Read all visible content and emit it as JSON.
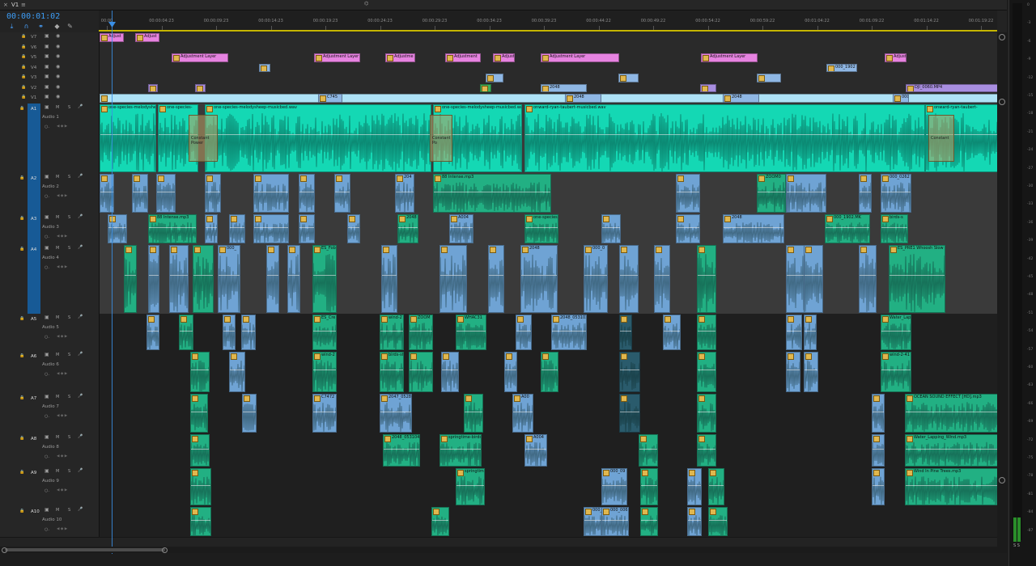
{
  "panel": {
    "tab_label": "V1",
    "menu_icon": "hamburger-menu-icon",
    "close_icon": "close-icon",
    "sequence_marker": "☰",
    "timecode": "00:00:01:02"
  },
  "tools": [
    "snap-icon",
    "linked-selection-icon",
    "add-marker-icon",
    "marker-icon",
    "wrench-icon"
  ],
  "ruler": {
    "labels": [
      "00:00",
      "00:00:04:23",
      "00:00:09:23",
      "00:00:14:23",
      "00:00:19:23",
      "00:00:24:23",
      "00:00:29:23",
      "00:00:34:23",
      "00:00:39:23",
      "00:00:44:22",
      "00:00:49:22",
      "00:00:54:22",
      "00:00:59:22",
      "00:01:04:22",
      "00:01:09:22",
      "00:01:14:22",
      "00:01:19:22"
    ]
  },
  "video_tracks": [
    {
      "label": "V7",
      "clips": [
        {
          "name": "Adjust"
        },
        {
          "name": "Adjust"
        }
      ]
    },
    {
      "label": "V6",
      "clips": []
    },
    {
      "label": "V5",
      "clips": [
        {
          "name": "Adjustment Layer"
        },
        {
          "name": "Adjustment Layer"
        },
        {
          "name": "Adjustme"
        },
        {
          "name": "Adjustment"
        },
        {
          "name": "Adjust"
        },
        {
          "name": "Adjustment Layer"
        },
        {
          "name": "Adjustment Layer"
        },
        {
          "name": "Adjust"
        }
      ]
    },
    {
      "label": "V4",
      "clips": [
        {
          "name": "000_1902"
        }
      ]
    },
    {
      "label": "V3",
      "clips": []
    },
    {
      "label": "V2",
      "clips": [
        {
          "name": "2048"
        },
        {
          "name": "DJI_0060.MP4"
        }
      ]
    },
    {
      "label": "V1",
      "clips": [
        {
          "name": "C745"
        },
        {
          "name": "2048"
        },
        {
          "name": "2048"
        },
        {
          "name": "000_"
        }
      ]
    }
  ],
  "audio_tracks": [
    {
      "label": "A1",
      "name": "Audio 1",
      "clips": [
        {
          "name": "one-species-melodyshee"
        },
        {
          "name": "one-species-"
        },
        {
          "name": "one-species-melodysheep-musicbed.wav"
        },
        {
          "name": "one-species-melodysheep-musicbed.wav"
        },
        {
          "name": "onward-ryan-taubert-musicbed.wav"
        },
        {
          "name": "onward-ryan-taubert-"
        }
      ],
      "transitions": [
        "Constant Power",
        "Constant Po",
        "Constant"
      ]
    },
    {
      "label": "A2",
      "name": "Audio 2",
      "clips": [
        {
          "name": "204"
        },
        {
          "name": "88 Intense.mp3"
        },
        {
          "name": "ZOOM0"
        },
        {
          "name": "000_0262"
        }
      ]
    },
    {
      "label": "A3",
      "name": "Audio 3",
      "clips": [
        {
          "name": "88 Intense.mp3"
        },
        {
          "name": "2048"
        },
        {
          "name": "A004"
        },
        {
          "name": "one-species"
        },
        {
          "name": "2048"
        },
        {
          "name": "000_1902.MK"
        },
        {
          "name": "birds-s"
        }
      ]
    },
    {
      "label": "A4",
      "name": "Audio 4",
      "clips": [
        {
          "name": "000_"
        },
        {
          "name": "ES_Fob"
        },
        {
          "name": "2048"
        },
        {
          "name": "000_0"
        },
        {
          "name": "ES_PRE1 Whoosh Slow 9"
        }
      ]
    },
    {
      "label": "A5",
      "name": "Audio 5",
      "clips": [
        {
          "name": "ES_Cre"
        },
        {
          "name": "wind-2"
        },
        {
          "name": "ZOOM"
        },
        {
          "name": "WHAC31"
        },
        {
          "name": "2048_053103"
        },
        {
          "name": "Water_Lap"
        }
      ]
    },
    {
      "label": "A6",
      "name": "Audio 6",
      "clips": [
        {
          "name": "wind-2"
        },
        {
          "name": "birds-st"
        },
        {
          "name": "wind-2-41"
        }
      ]
    },
    {
      "label": "A7",
      "name": "Audio 7",
      "clips": [
        {
          "name": "C7472"
        },
        {
          "name": "2047_0528"
        },
        {
          "name": "A00"
        },
        {
          "name": "OCEAN SOUND EFFECT [HD].mp3"
        }
      ]
    },
    {
      "label": "A8",
      "name": "Audio 8",
      "clips": [
        {
          "name": "2048_053104"
        },
        {
          "name": "springtime-birds"
        },
        {
          "name": "A004"
        },
        {
          "name": "Water_Lapping_Wind.mp3"
        }
      ]
    },
    {
      "label": "A9",
      "name": "Audio 9",
      "clips": [
        {
          "name": "springtim"
        },
        {
          "name": "000_09"
        },
        {
          "name": "Wind In Pine Trees.mp3"
        }
      ]
    },
    {
      "label": "A10",
      "name": "Audio 10",
      "clips": [
        {
          "name": "000_0"
        },
        {
          "name": "000_0066"
        }
      ]
    }
  ],
  "meter": {
    "labels": [
      "0",
      "-3",
      "-6",
      "-9",
      "-12",
      "-15",
      "-18",
      "-21",
      "-24",
      "-27",
      "-30",
      "-33",
      "-36",
      "-39",
      "-42",
      "-45",
      "-48",
      "-51",
      "-54",
      "-57",
      "-60",
      "-63",
      "-66",
      "-69",
      "-72",
      "-75",
      "-78",
      "-81",
      "-84",
      "-87"
    ],
    "footer": "S S"
  },
  "colors": {
    "timecode": "#3d9df6",
    "playhead": "#3a8fe6",
    "adjustment": "#e683e0",
    "audio_a1": "#14d8b4",
    "audio_blue": "#6fa3d4",
    "audio_green": "#22b083",
    "work_area": "#c6b600"
  }
}
